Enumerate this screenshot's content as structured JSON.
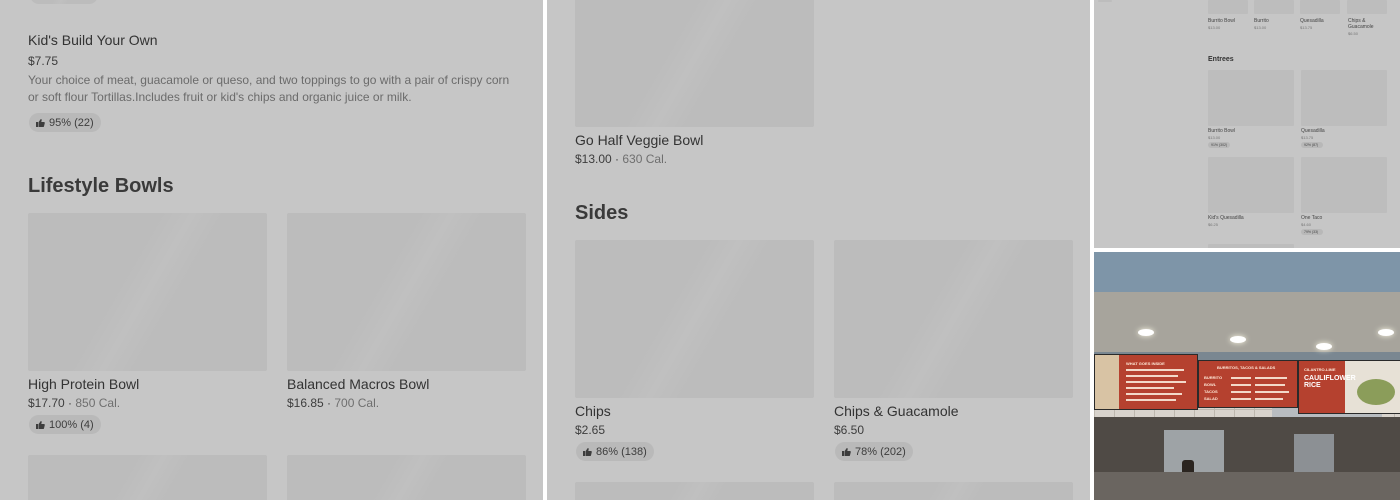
{
  "panel1": {
    "kids": {
      "title": "Kid's Build Your Own",
      "price": "$7.75",
      "desc": "Your choice of meat, guacamole or queso, and two toppings to go with a pair of crispy corn or soft flour Tortillas.Includes fruit or kid's chips and organic juice or milk.",
      "rating": "95% (22)"
    },
    "section": "Lifestyle Bowls",
    "items": [
      {
        "title": "High Protein Bowl",
        "price": "$17.70",
        "cal": "850 Cal.",
        "rating": "100% (4)"
      },
      {
        "title": "Balanced Macros Bowl",
        "price": "$16.85",
        "cal": "700 Cal."
      }
    ]
  },
  "panel2": {
    "top_item": {
      "title": "Go Half Veggie Bowl",
      "price": "$13.00",
      "cal": "630 Cal."
    },
    "section": "Sides",
    "items": [
      {
        "title": "Chips",
        "price": "$2.65",
        "rating": "86% (138)"
      },
      {
        "title": "Chips & Guacamole",
        "price": "$6.50",
        "rating": "78% (202)"
      }
    ]
  },
  "panel3": {
    "top_items": [
      {
        "title": "Burrito Bowl",
        "price": "$13.00"
      },
      {
        "title": "Burrito",
        "price": "$13.00"
      },
      {
        "title": "Quesadilla",
        "price": "$13.75"
      },
      {
        "title": "Chips & Guacamole",
        "price": "$6.50"
      }
    ],
    "section": "Entrees",
    "entrees": [
      {
        "title": "Burrito Bowl",
        "price": "$13.00",
        "rating": "91% (302)"
      },
      {
        "title": "Quesadilla",
        "price": "$13.75",
        "rating": "92% (87)"
      },
      {
        "title": "Kid's Quesadilla",
        "price": "$6.25"
      },
      {
        "title": "One Taco",
        "price": "$4.60",
        "rating": "79% (33)"
      }
    ]
  },
  "photo": {
    "board1_title": "WHAT GOES INSIDE",
    "board2_title": "BURRITOS, TACOS & SALADS",
    "board2_rows": [
      "BURRITO",
      "BOWL",
      "TACOS",
      "SALAD"
    ],
    "board3_title": "CILANTRO-LIME",
    "board3_big": "CAULIFLOWER RICE"
  },
  "colors": {
    "overlay_bg": "#c6c6c6",
    "placeholder": "#bcbcbc",
    "menu_red": "#b5412f"
  },
  "icons": {
    "rating": "thumbs-up-icon"
  }
}
